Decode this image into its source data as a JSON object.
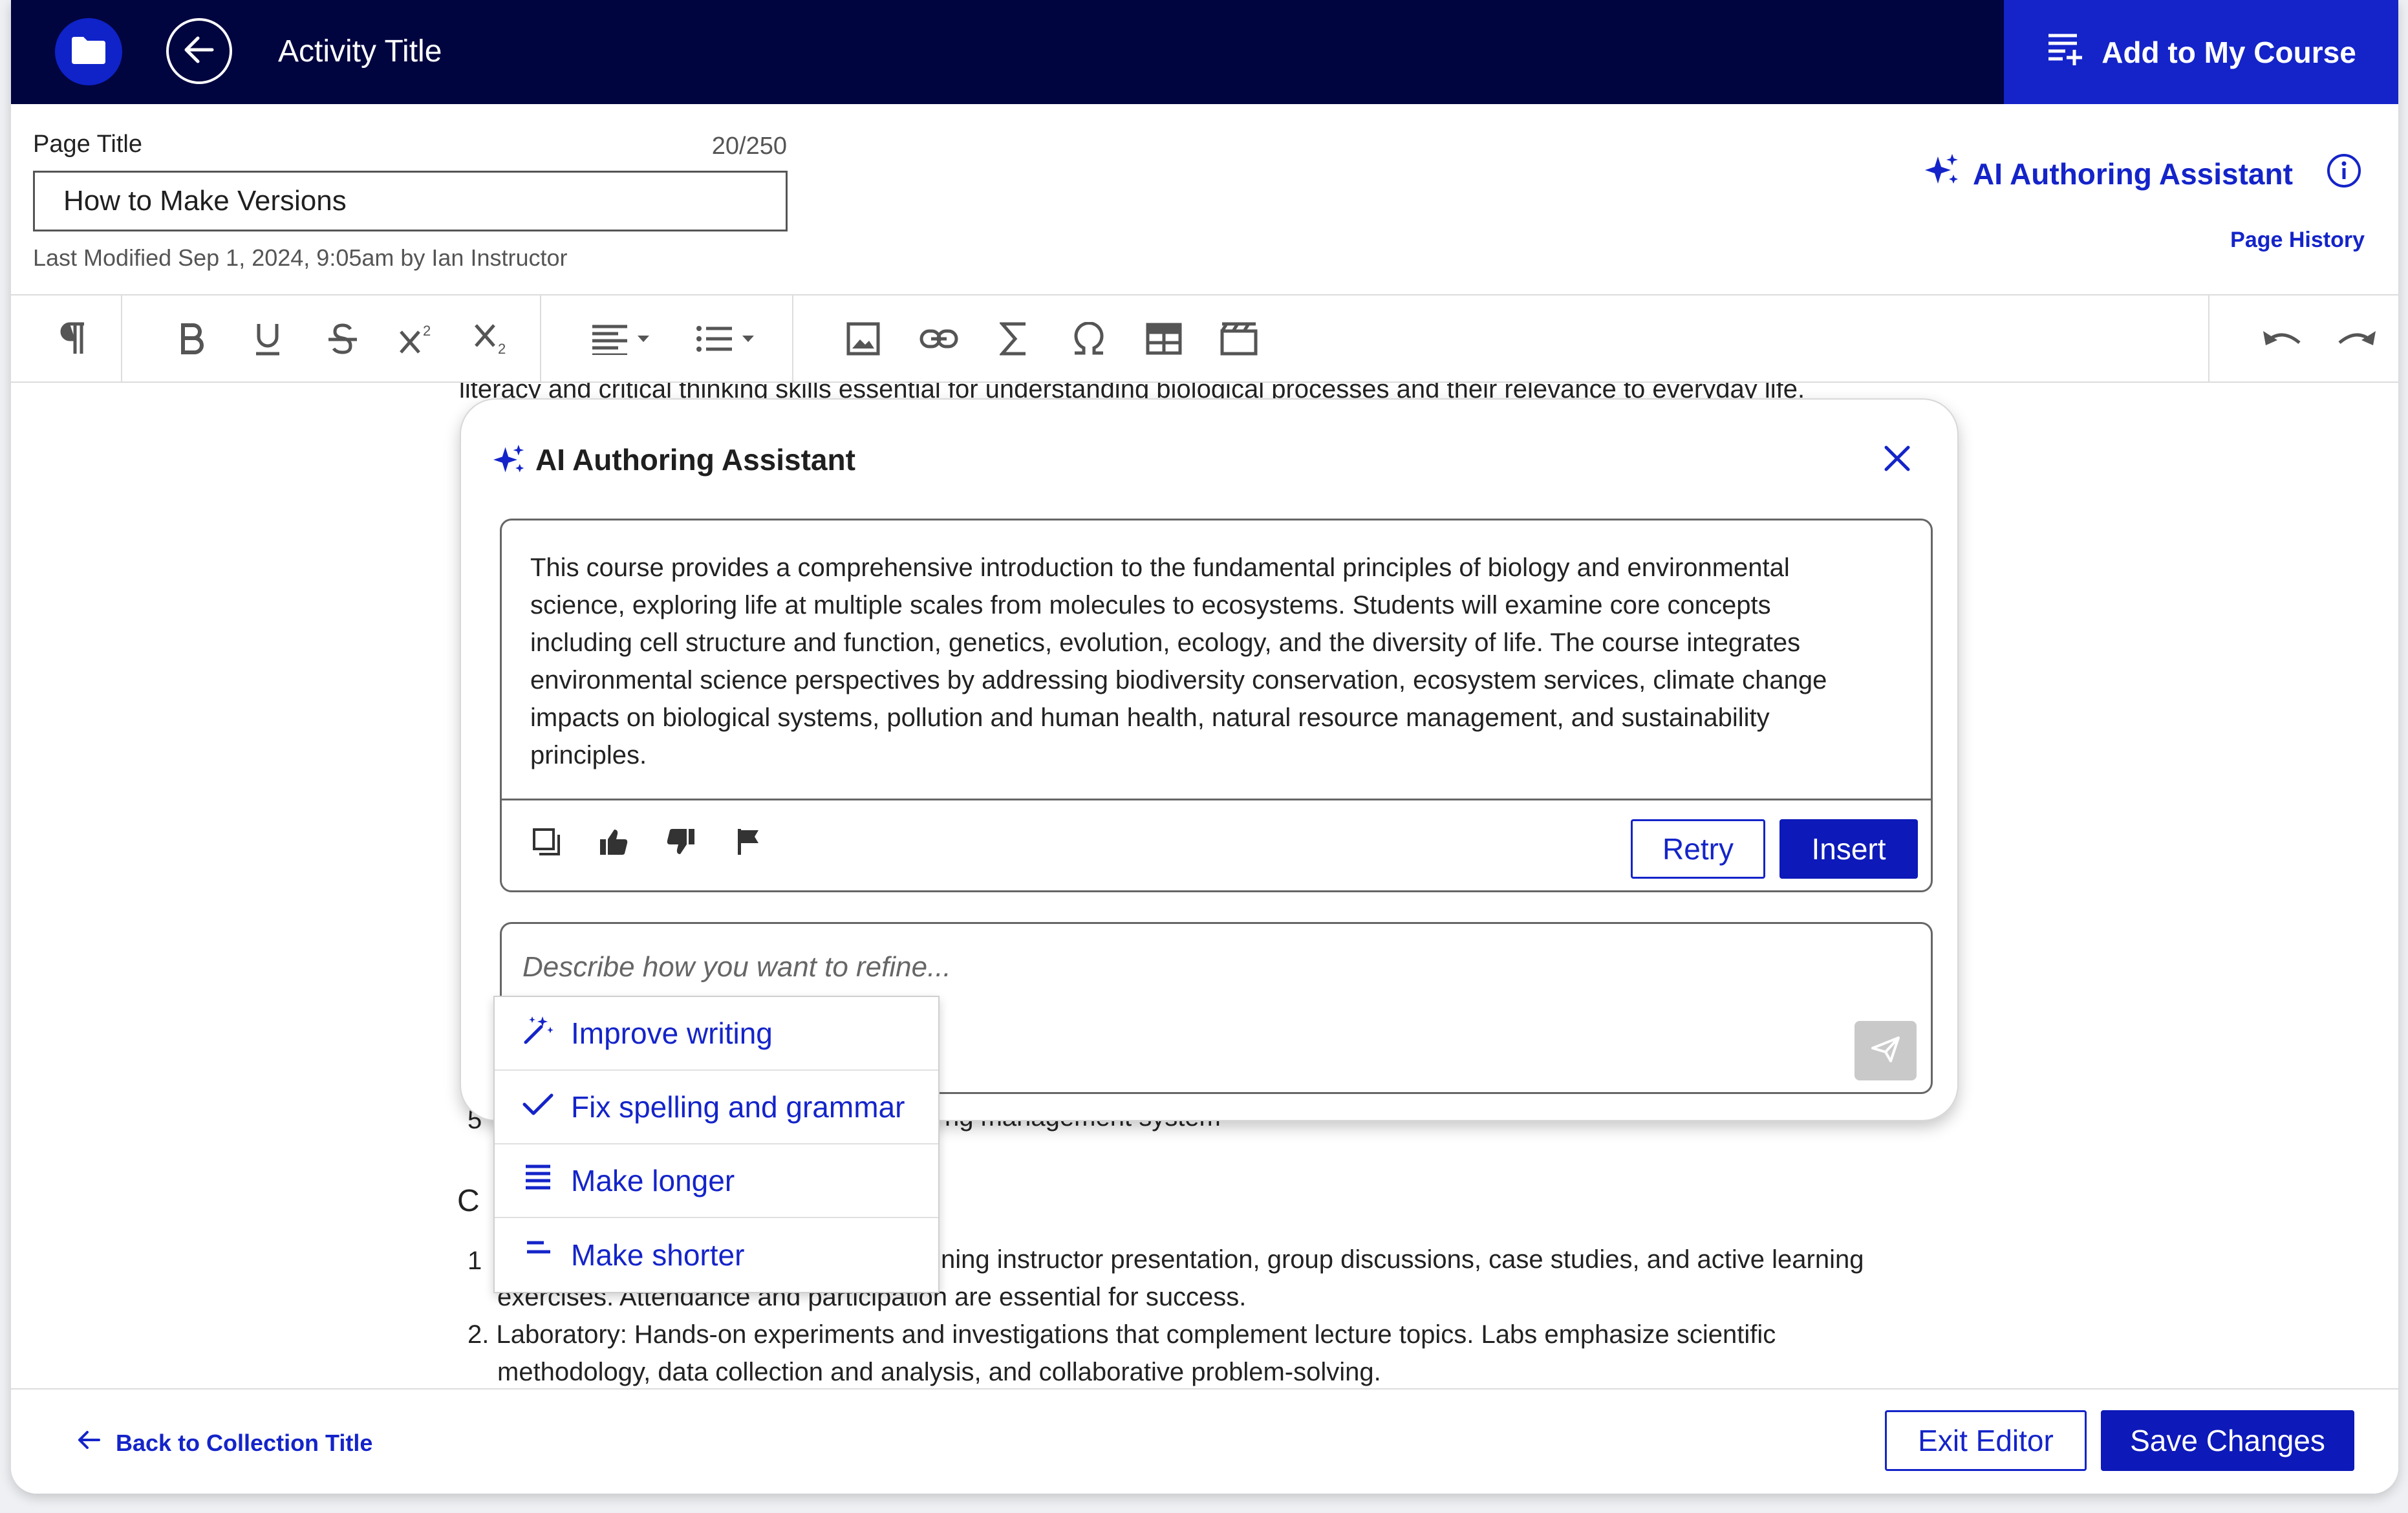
{
  "header": {
    "activity_title": "Activity Title",
    "add_course_label": "Add to My Course",
    "icons": [
      "folder-icon",
      "arrow-left-icon",
      "playlist-add-icon"
    ]
  },
  "page_title": {
    "label": "Page Title",
    "char_count": "20/250",
    "value": "How to Make Versions",
    "last_modified": "Last Modified Sep 1, 2024, 9:05am by Ian Instructor"
  },
  "ai_assistant_link": "AI Authoring Assistant",
  "page_history": "Page History",
  "toolbar": {
    "icons": [
      "paragraph-icon",
      "bold-icon",
      "underline-icon",
      "strikethrough-icon",
      "superscript-icon",
      "subscript-icon",
      "align-icon",
      "list-icon",
      "image-icon",
      "link-icon",
      "sigma-icon",
      "omega-icon",
      "table-icon",
      "media-icon",
      "undo-icon",
      "redo-icon"
    ]
  },
  "document": {
    "line_top": "literacy and critical thinking skills essential for understanding biological processes and their relevance to everyday life.",
    "list_item_5_fragment": "ng management system",
    "list_item_5_number": "5",
    "heading_fragment": "C",
    "item1_number": "1",
    "item1_line1_fragment": "ning instructor presentation, group discussions, case studies, and active learning",
    "item1_line2": "exercises. Attendance and participation are essential for success.",
    "item2_line1": "2. Laboratory: Hands-on experiments and investigations that complement lecture topics. Labs emphasize scientific",
    "item2_line2": "methodology, data collection and analysis, and collaborative problem-solving."
  },
  "dialog": {
    "title": "AI Authoring Assistant",
    "response": "This course provides a comprehensive introduction to the fundamental principles of biology and environmental\nscience, exploring life at multiple scales from molecules to ecosystems. Students will examine core concepts\nincluding cell structure and function, genetics, evolution, ecology, and the diversity of life. The course integrates\nenvironmental science perspectives by addressing biodiversity conservation, ecosystem services, climate change\nimpacts on biological systems, pollution and human health, natural resource management, and sustainability\nprinciples.",
    "retry_label": "Retry",
    "insert_label": "Insert",
    "refine_placeholder": "Describe how you want to refine...",
    "suggestions": [
      {
        "label": "Improve writing",
        "icon": "magic-wand-icon"
      },
      {
        "label": "Fix spelling and grammar",
        "icon": "check-icon"
      },
      {
        "label": "Make longer",
        "icon": "lines-long-icon"
      },
      {
        "label": "Make shorter",
        "icon": "lines-short-icon"
      }
    ]
  },
  "footer": {
    "back_label": "Back to Collection Title",
    "exit_label": "Exit Editor",
    "save_label": "Save Changes"
  },
  "colors": {
    "nav_bg": "#00053f",
    "accent": "#1424c9",
    "primary_button": "#0d19b8"
  }
}
